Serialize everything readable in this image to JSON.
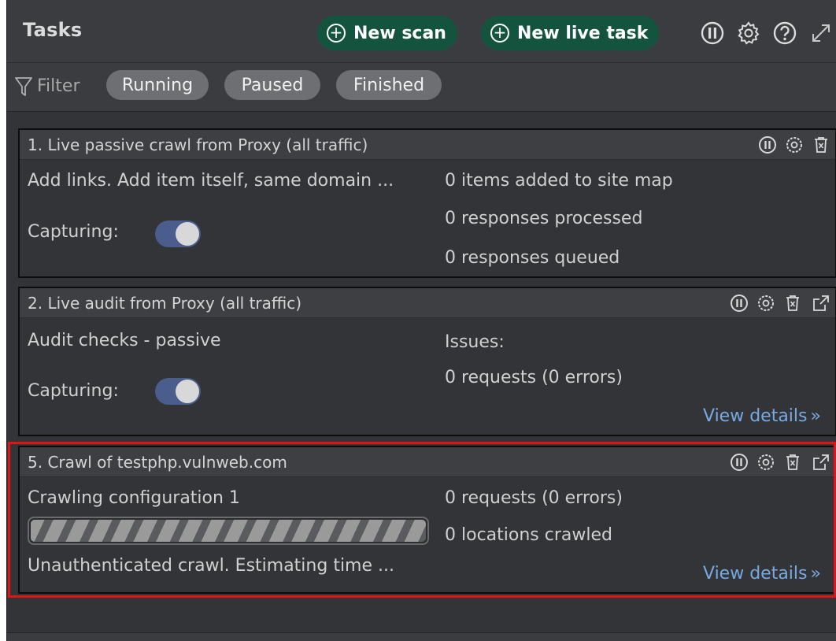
{
  "header": {
    "title": "Tasks",
    "new_scan_label": "New scan",
    "new_live_task_label": "New live task",
    "accent_color": "#14543f"
  },
  "filter": {
    "label": "Filter",
    "chips": [
      "Running",
      "Paused",
      "Finished"
    ]
  },
  "tasks": [
    {
      "title": "1. Live passive crawl from Proxy (all traffic)",
      "description": "Add links. Add item itself, same domain ...",
      "capturing_label": "Capturing:",
      "capturing_on": true,
      "stats": [
        "0 items added to site map",
        "0 responses processed",
        "0 responses queued"
      ]
    },
    {
      "title": "2. Live audit from Proxy (all traffic)",
      "description": "Audit checks - passive",
      "capturing_label": "Capturing:",
      "capturing_on": true,
      "stats": [
        "Issues:",
        "0 requests (0 errors)"
      ],
      "link": "View details"
    },
    {
      "title": "5. Crawl of testphp.vulnweb.com",
      "description": "Crawling configuration 1",
      "status": "Unauthenticated crawl. Estimating time ...",
      "stats": [
        "0 requests (0 errors)",
        "0 locations crawled"
      ],
      "link": "View details",
      "selected": true
    }
  ],
  "icons": [
    "pause-icon",
    "gear-icon",
    "help-icon",
    "expand-icon",
    "filter-icon",
    "trash-icon",
    "open-external-icon"
  ]
}
